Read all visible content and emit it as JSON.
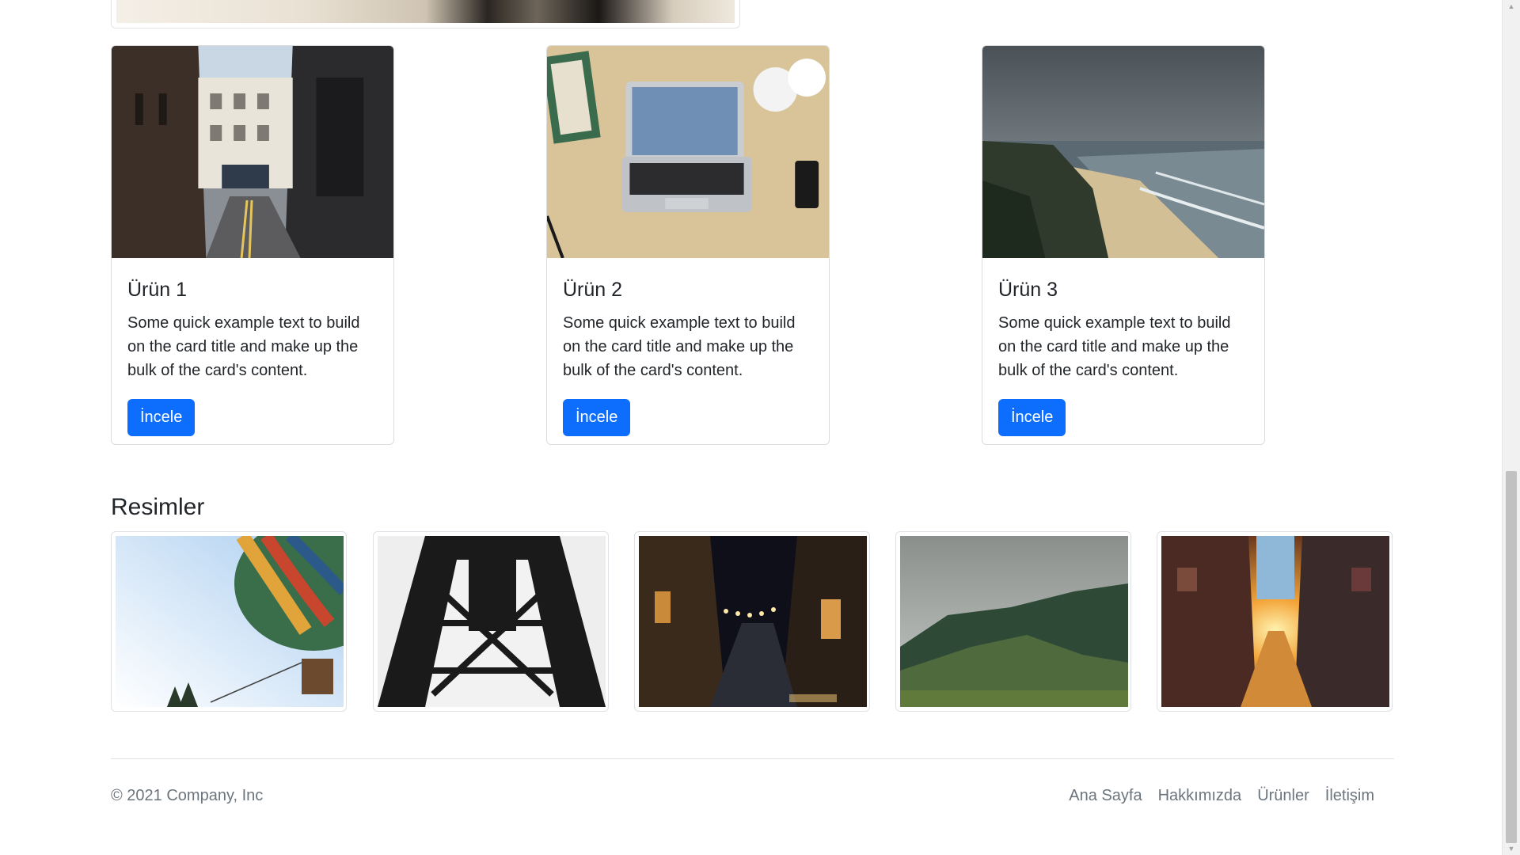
{
  "products": [
    {
      "title": "Ürün 1",
      "text": "Some quick example text to build on the card title and make up the bulk of the card's content.",
      "button": "İncele"
    },
    {
      "title": "Ürün 2",
      "text": "Some quick example text to build on the card title and make up the bulk of the card's content.",
      "button": "İncele"
    },
    {
      "title": "Ürün 3",
      "text": "Some quick example text to build on the card title and make up the bulk of the card's content.",
      "button": "İncele"
    }
  ],
  "gallery": {
    "title": "Resimler"
  },
  "footer": {
    "copyright": "© 2021 Company, Inc",
    "links": [
      "Ana Sayfa",
      "Hakkımızda",
      "Ürünler",
      "İletişim"
    ]
  },
  "colors": {
    "primary": "#0d6efd",
    "muted": "#6c757d",
    "border": "#dee2e6"
  }
}
